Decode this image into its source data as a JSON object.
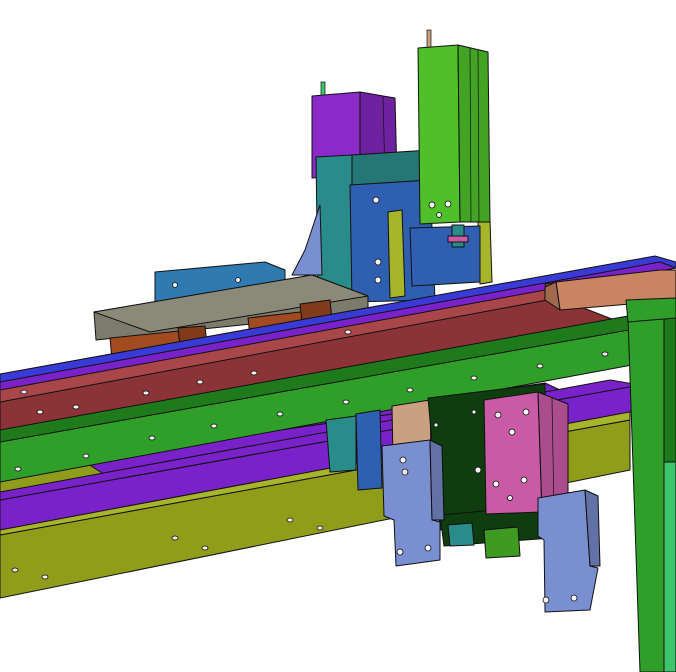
{
  "scene": {
    "type": "cad-assembly-render",
    "background": "#ffffff",
    "palette": {
      "green_frame": "#2f9f2a",
      "green_frame_dark": "#1f7a1c",
      "red_rail": "#8c3338",
      "red_rail_top": "#a9464a",
      "purple_rail": "#7a22c9",
      "blue_strip": "#3a3ad6",
      "olive_beam": "#8f9d1a",
      "olive_beam_top": "#a7b52a",
      "tan_block": "#c98562",
      "gray_plate": "#7c7b6c",
      "orange_block": "#a24a20",
      "violet_cylinder": "#8a2ac8",
      "lime_cylinder": "#4fc02a",
      "teal_plate": "#2a8c8a",
      "blue_carriage": "#2f5fb0",
      "steel_blue_plate": "#2f7ab0",
      "pink_cylinder": "#c95aa5",
      "light_blue_bracket": "#7a8fd0",
      "dark_green_block": "#0f3d10",
      "tan_plate": "#c9a080",
      "mint_panel": "#3ec46a"
    },
    "components": [
      "green-frame",
      "red-rail",
      "purple-rail",
      "olive-beam",
      "gray-plate",
      "violet-cylinder",
      "lime-cylinder",
      "blue-carriage",
      "pink-cylinder",
      "bracket-left",
      "bracket-right"
    ]
  }
}
